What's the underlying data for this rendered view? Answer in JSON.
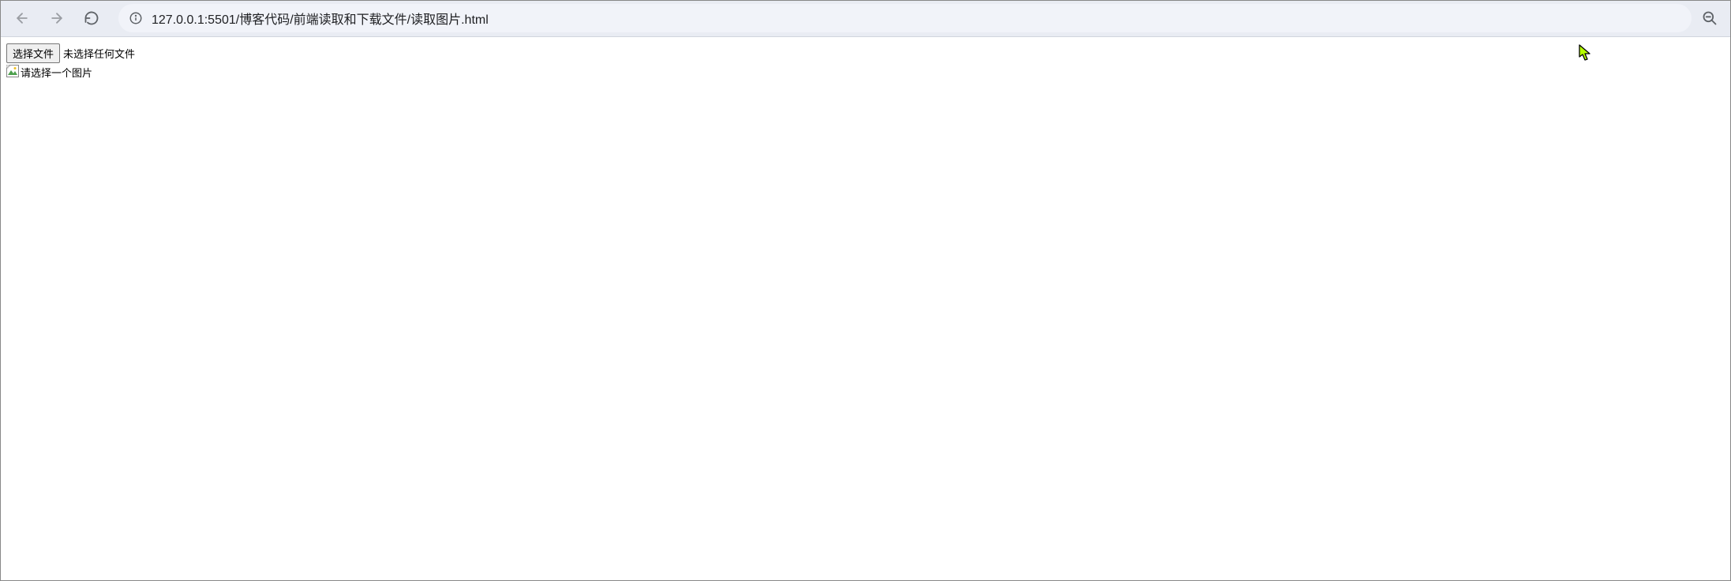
{
  "addressBar": {
    "url": "127.0.0.1:5501/博客代码/前端读取和下载文件/读取图片.html"
  },
  "page": {
    "fileInput": {
      "buttonLabel": "选择文件",
      "statusText": "未选择任何文件"
    },
    "image": {
      "altText": "请选择一个图片"
    }
  }
}
